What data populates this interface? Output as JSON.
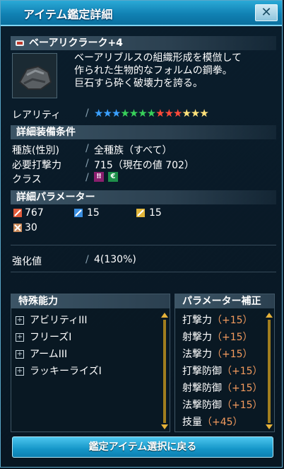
{
  "window": {
    "title": "アイテム鑑定詳細",
    "close": "✕"
  },
  "item": {
    "name": "ベーアリクラーク+4",
    "description": [
      "ベーアリブルスの組織形成を模倣して",
      "作られた生物的なフォルムの鋼拳。",
      "巨石すら砕く破壊力を誇る。"
    ]
  },
  "rarity": {
    "label": "レアリティ",
    "stars": 13
  },
  "requirements": {
    "title": "詳細装備条件",
    "race_label": "種族(性別)",
    "race_value": "全種族（すべて）",
    "attack_label": "必要打撃力",
    "attack_value": "715（現在の値 702）",
    "class_label": "クラス"
  },
  "params": {
    "title": "詳細パラメーター",
    "stat1": "767",
    "stat2": "15",
    "stat3": "15",
    "stat4": "30",
    "grind_label": "強化値",
    "grind_value": "4(130%)"
  },
  "abilities": {
    "title": "特殊能力",
    "items": [
      "アビリティIII",
      "フリーズI",
      "アームIII",
      "ラッキーライズI"
    ]
  },
  "param_bonus": {
    "title": "パラメーター補正",
    "items": [
      {
        "name": "打撃力",
        "value": "（+15）"
      },
      {
        "name": "射撃力",
        "value": "（+15）"
      },
      {
        "name": "法撃力",
        "value": "（+15）"
      },
      {
        "name": "打撃防御",
        "value": "（+15）"
      },
      {
        "name": "射撃防御",
        "value": "（+15）"
      },
      {
        "name": "法撃防御",
        "value": "（+15）"
      },
      {
        "name": "技量",
        "value": "（+45）"
      }
    ]
  },
  "footer": {
    "button": "鑑定アイテム選択に戻る"
  },
  "colors": {
    "accent": "#1596c8",
    "bonus": "#f39b5e"
  }
}
